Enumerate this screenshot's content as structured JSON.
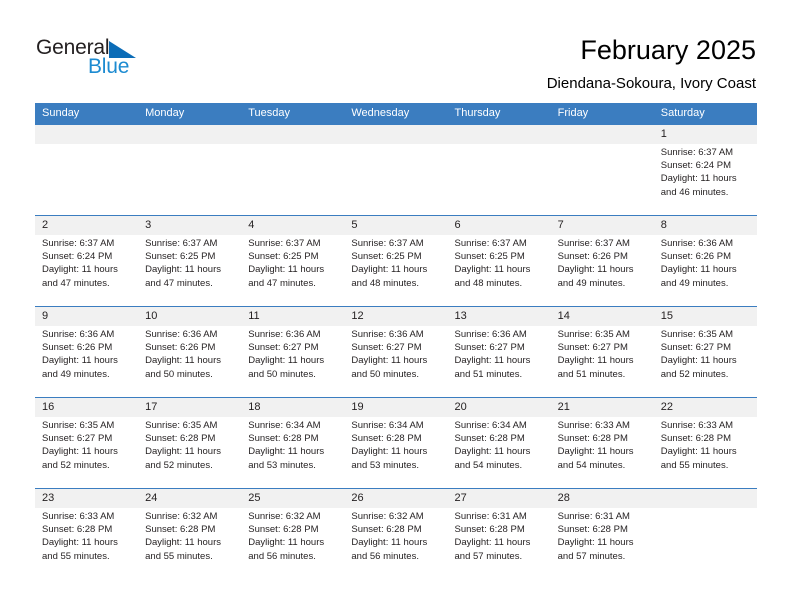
{
  "brand": {
    "name_part1": "General",
    "name_part2": "Blue",
    "accent_color": "#0b6cb7",
    "accent_light": "#1d8bd1"
  },
  "header": {
    "month_title": "February 2025",
    "location": "Diendana-Sokoura, Ivory Coast"
  },
  "theme": {
    "header_row_color": "#3b7dc0",
    "date_band_color": "#f1f1f1",
    "text_color": "#231f20"
  },
  "weekdays": [
    "Sunday",
    "Monday",
    "Tuesday",
    "Wednesday",
    "Thursday",
    "Friday",
    "Saturday"
  ],
  "weeks": [
    {
      "days": [
        {
          "date": "",
          "sunrise": "",
          "sunset": "",
          "daylight_line1": "",
          "daylight_line2": ""
        },
        {
          "date": "",
          "sunrise": "",
          "sunset": "",
          "daylight_line1": "",
          "daylight_line2": ""
        },
        {
          "date": "",
          "sunrise": "",
          "sunset": "",
          "daylight_line1": "",
          "daylight_line2": ""
        },
        {
          "date": "",
          "sunrise": "",
          "sunset": "",
          "daylight_line1": "",
          "daylight_line2": ""
        },
        {
          "date": "",
          "sunrise": "",
          "sunset": "",
          "daylight_line1": "",
          "daylight_line2": ""
        },
        {
          "date": "",
          "sunrise": "",
          "sunset": "",
          "daylight_line1": "",
          "daylight_line2": ""
        },
        {
          "date": "1",
          "sunrise": "Sunrise: 6:37 AM",
          "sunset": "Sunset: 6:24 PM",
          "daylight_line1": "Daylight: 11 hours",
          "daylight_line2": "and 46 minutes."
        }
      ]
    },
    {
      "days": [
        {
          "date": "2",
          "sunrise": "Sunrise: 6:37 AM",
          "sunset": "Sunset: 6:24 PM",
          "daylight_line1": "Daylight: 11 hours",
          "daylight_line2": "and 47 minutes."
        },
        {
          "date": "3",
          "sunrise": "Sunrise: 6:37 AM",
          "sunset": "Sunset: 6:25 PM",
          "daylight_line1": "Daylight: 11 hours",
          "daylight_line2": "and 47 minutes."
        },
        {
          "date": "4",
          "sunrise": "Sunrise: 6:37 AM",
          "sunset": "Sunset: 6:25 PM",
          "daylight_line1": "Daylight: 11 hours",
          "daylight_line2": "and 47 minutes."
        },
        {
          "date": "5",
          "sunrise": "Sunrise: 6:37 AM",
          "sunset": "Sunset: 6:25 PM",
          "daylight_line1": "Daylight: 11 hours",
          "daylight_line2": "and 48 minutes."
        },
        {
          "date": "6",
          "sunrise": "Sunrise: 6:37 AM",
          "sunset": "Sunset: 6:25 PM",
          "daylight_line1": "Daylight: 11 hours",
          "daylight_line2": "and 48 minutes."
        },
        {
          "date": "7",
          "sunrise": "Sunrise: 6:37 AM",
          "sunset": "Sunset: 6:26 PM",
          "daylight_line1": "Daylight: 11 hours",
          "daylight_line2": "and 49 minutes."
        },
        {
          "date": "8",
          "sunrise": "Sunrise: 6:36 AM",
          "sunset": "Sunset: 6:26 PM",
          "daylight_line1": "Daylight: 11 hours",
          "daylight_line2": "and 49 minutes."
        }
      ]
    },
    {
      "days": [
        {
          "date": "9",
          "sunrise": "Sunrise: 6:36 AM",
          "sunset": "Sunset: 6:26 PM",
          "daylight_line1": "Daylight: 11 hours",
          "daylight_line2": "and 49 minutes."
        },
        {
          "date": "10",
          "sunrise": "Sunrise: 6:36 AM",
          "sunset": "Sunset: 6:26 PM",
          "daylight_line1": "Daylight: 11 hours",
          "daylight_line2": "and 50 minutes."
        },
        {
          "date": "11",
          "sunrise": "Sunrise: 6:36 AM",
          "sunset": "Sunset: 6:27 PM",
          "daylight_line1": "Daylight: 11 hours",
          "daylight_line2": "and 50 minutes."
        },
        {
          "date": "12",
          "sunrise": "Sunrise: 6:36 AM",
          "sunset": "Sunset: 6:27 PM",
          "daylight_line1": "Daylight: 11 hours",
          "daylight_line2": "and 50 minutes."
        },
        {
          "date": "13",
          "sunrise": "Sunrise: 6:36 AM",
          "sunset": "Sunset: 6:27 PM",
          "daylight_line1": "Daylight: 11 hours",
          "daylight_line2": "and 51 minutes."
        },
        {
          "date": "14",
          "sunrise": "Sunrise: 6:35 AM",
          "sunset": "Sunset: 6:27 PM",
          "daylight_line1": "Daylight: 11 hours",
          "daylight_line2": "and 51 minutes."
        },
        {
          "date": "15",
          "sunrise": "Sunrise: 6:35 AM",
          "sunset": "Sunset: 6:27 PM",
          "daylight_line1": "Daylight: 11 hours",
          "daylight_line2": "and 52 minutes."
        }
      ]
    },
    {
      "days": [
        {
          "date": "16",
          "sunrise": "Sunrise: 6:35 AM",
          "sunset": "Sunset: 6:27 PM",
          "daylight_line1": "Daylight: 11 hours",
          "daylight_line2": "and 52 minutes."
        },
        {
          "date": "17",
          "sunrise": "Sunrise: 6:35 AM",
          "sunset": "Sunset: 6:28 PM",
          "daylight_line1": "Daylight: 11 hours",
          "daylight_line2": "and 52 minutes."
        },
        {
          "date": "18",
          "sunrise": "Sunrise: 6:34 AM",
          "sunset": "Sunset: 6:28 PM",
          "daylight_line1": "Daylight: 11 hours",
          "daylight_line2": "and 53 minutes."
        },
        {
          "date": "19",
          "sunrise": "Sunrise: 6:34 AM",
          "sunset": "Sunset: 6:28 PM",
          "daylight_line1": "Daylight: 11 hours",
          "daylight_line2": "and 53 minutes."
        },
        {
          "date": "20",
          "sunrise": "Sunrise: 6:34 AM",
          "sunset": "Sunset: 6:28 PM",
          "daylight_line1": "Daylight: 11 hours",
          "daylight_line2": "and 54 minutes."
        },
        {
          "date": "21",
          "sunrise": "Sunrise: 6:33 AM",
          "sunset": "Sunset: 6:28 PM",
          "daylight_line1": "Daylight: 11 hours",
          "daylight_line2": "and 54 minutes."
        },
        {
          "date": "22",
          "sunrise": "Sunrise: 6:33 AM",
          "sunset": "Sunset: 6:28 PM",
          "daylight_line1": "Daylight: 11 hours",
          "daylight_line2": "and 55 minutes."
        }
      ]
    },
    {
      "days": [
        {
          "date": "23",
          "sunrise": "Sunrise: 6:33 AM",
          "sunset": "Sunset: 6:28 PM",
          "daylight_line1": "Daylight: 11 hours",
          "daylight_line2": "and 55 minutes."
        },
        {
          "date": "24",
          "sunrise": "Sunrise: 6:32 AM",
          "sunset": "Sunset: 6:28 PM",
          "daylight_line1": "Daylight: 11 hours",
          "daylight_line2": "and 55 minutes."
        },
        {
          "date": "25",
          "sunrise": "Sunrise: 6:32 AM",
          "sunset": "Sunset: 6:28 PM",
          "daylight_line1": "Daylight: 11 hours",
          "daylight_line2": "and 56 minutes."
        },
        {
          "date": "26",
          "sunrise": "Sunrise: 6:32 AM",
          "sunset": "Sunset: 6:28 PM",
          "daylight_line1": "Daylight: 11 hours",
          "daylight_line2": "and 56 minutes."
        },
        {
          "date": "27",
          "sunrise": "Sunrise: 6:31 AM",
          "sunset": "Sunset: 6:28 PM",
          "daylight_line1": "Daylight: 11 hours",
          "daylight_line2": "and 57 minutes."
        },
        {
          "date": "28",
          "sunrise": "Sunrise: 6:31 AM",
          "sunset": "Sunset: 6:28 PM",
          "daylight_line1": "Daylight: 11 hours",
          "daylight_line2": "and 57 minutes."
        },
        {
          "date": "",
          "sunrise": "",
          "sunset": "",
          "daylight_line1": "",
          "daylight_line2": ""
        }
      ]
    }
  ]
}
